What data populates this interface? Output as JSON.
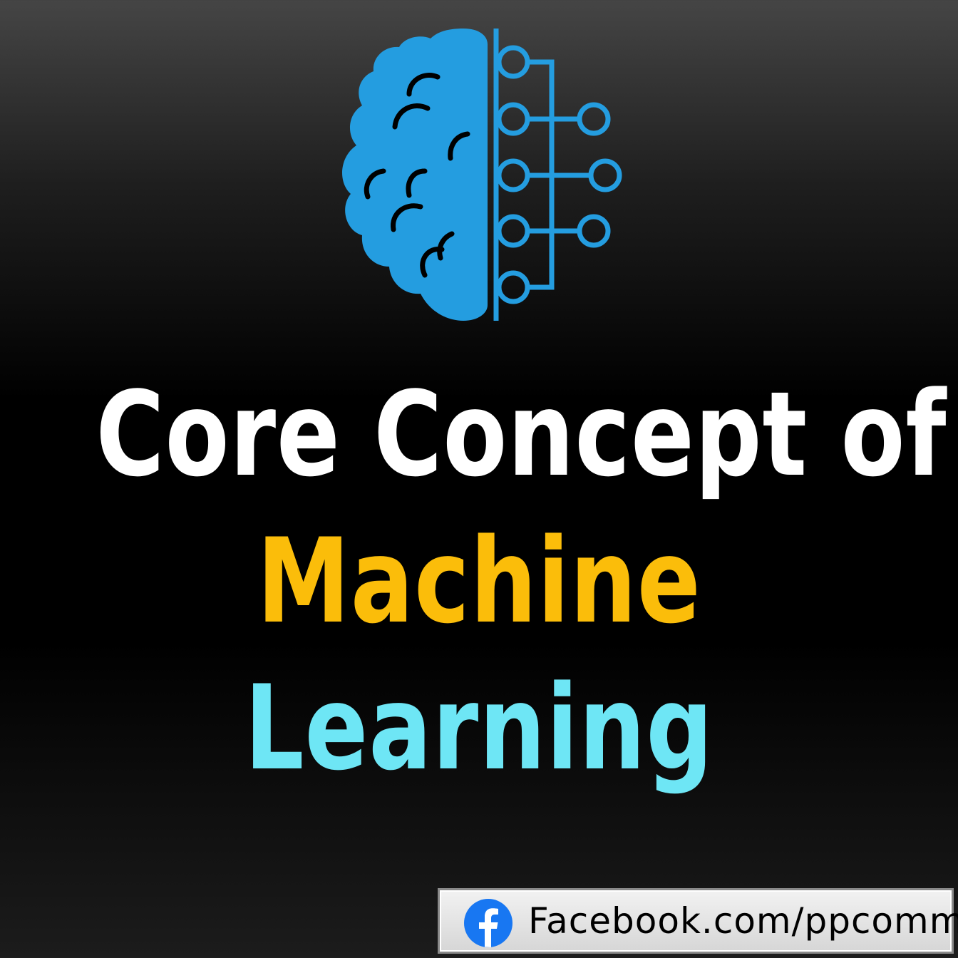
{
  "title": {
    "line1": "Core Concept of",
    "line2": "Machine",
    "line3": "Learning"
  },
  "footer": {
    "link_text": "Facebook.com/ppcomm",
    "icon": "facebook-icon"
  },
  "logo": {
    "icon": "brain-circuit-icon"
  },
  "colors": {
    "line1": "#ffffff",
    "line2": "#fbbd0a",
    "line3": "#6ee6f5",
    "brain": "#249de0",
    "facebook": "#1877f2",
    "background_top": "#454545",
    "background_bottom": "#000000"
  }
}
